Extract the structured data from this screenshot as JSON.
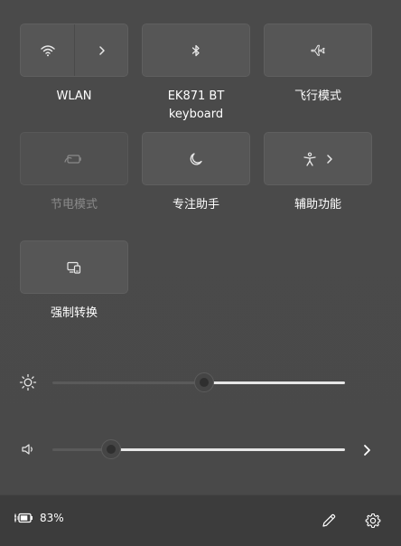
{
  "tiles": {
    "wlan": {
      "label": "WLAN"
    },
    "bluetooth": {
      "label_line1": "EK871 BT",
      "label_line2": "keyboard"
    },
    "airplane": {
      "label": "飞行模式"
    },
    "battery_saver": {
      "label": "节电模式"
    },
    "focus_assist": {
      "label": "专注助手"
    },
    "accessibility": {
      "label": "辅助功能"
    },
    "cast": {
      "label": "强制转换"
    }
  },
  "sliders": {
    "brightness": {
      "value": 0.52
    },
    "volume": {
      "value": 0.2
    }
  },
  "footer": {
    "battery_percent": "83%"
  },
  "colors": {
    "panel_bg": "#4a4a4a",
    "tile_bg": "#565656",
    "footer_bg": "#3c3c3c",
    "slider_fill": "#e6e6e6",
    "dim_text": "#8a8a8a"
  },
  "icons": {
    "wlan": "wifi-icon",
    "wlan_expand": "chevron-right-icon",
    "bluetooth": "bluetooth-icon",
    "airplane": "airplane-icon",
    "battery_saver": "battery-saver-icon",
    "focus_assist": "moon-icon",
    "accessibility": "accessibility-icon",
    "cast": "cast-icon",
    "brightness": "sun-icon",
    "volume": "speaker-icon",
    "edit": "pencil-icon",
    "settings": "gear-icon"
  }
}
